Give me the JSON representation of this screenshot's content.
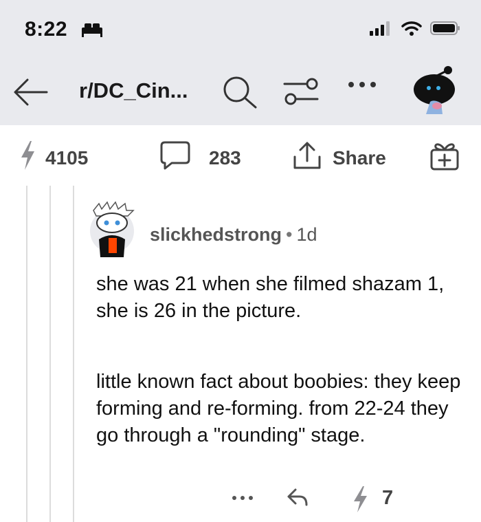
{
  "status": {
    "time": "8:22"
  },
  "nav": {
    "subreddit": "r/DC_Cin..."
  },
  "actions": {
    "upvotes": "4105",
    "comments": "283",
    "share": "Share"
  },
  "comment": {
    "author": "slickhedstrong",
    "separator": "•",
    "age": "1d",
    "paragraph1": "she was 21 when she filmed shazam 1, she is 26 in the picture.",
    "paragraph2": "little known fact about boobies: they keep forming and re-forming. from 22-24 they go through a  \"rounding\" stage.",
    "score": "7"
  },
  "icons": {
    "status_sleep": "bed-icon",
    "signal": "cellular-signal-icon",
    "wifi": "wifi-icon",
    "battery": "battery-icon",
    "back": "back-arrow-icon",
    "search": "search-icon",
    "filter": "filter-icon",
    "more": "more-icon",
    "upvote": "upvote-icon",
    "comment": "comment-icon",
    "share": "share-icon",
    "award": "gift-icon",
    "reply": "reply-icon"
  },
  "colors": {
    "topbar": "#e9eaee",
    "text": "#1a1a1b",
    "muted": "#555555",
    "thread_line": "#dcdcdc"
  }
}
